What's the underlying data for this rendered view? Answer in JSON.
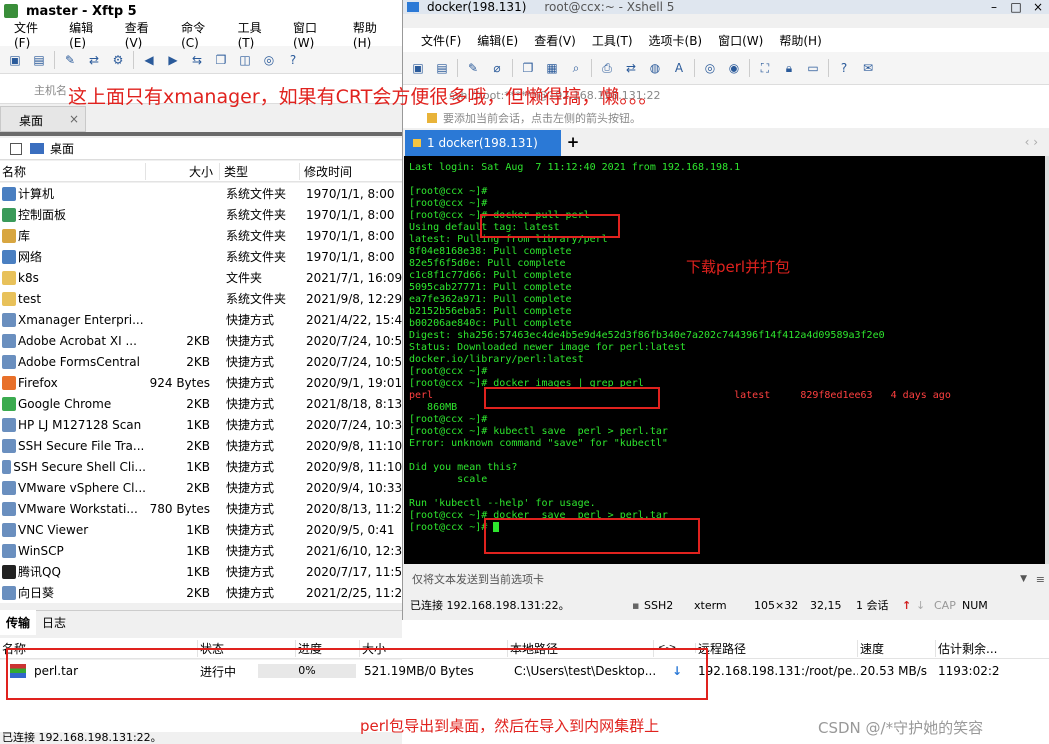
{
  "xftp": {
    "title": "master  - Xftp 5",
    "menu": [
      "文件(F)",
      "编辑(E)",
      "查看(V)",
      "命令(C)",
      "工具(T)",
      "窗口(W)",
      "帮助(H)"
    ],
    "address_placeholder": "主机名",
    "tab": "桌面",
    "path": "桌面",
    "columns": [
      "名称",
      "大小",
      "类型",
      "修改时间"
    ],
    "files": [
      {
        "name": "计算机",
        "size": "",
        "type": "系统文件夹",
        "date": "1970/1/1, 8:00",
        "icon": "computer-icon"
      },
      {
        "name": "控制面板",
        "size": "",
        "type": "系统文件夹",
        "date": "1970/1/1, 8:00",
        "icon": "control-panel-icon"
      },
      {
        "name": "库",
        "size": "",
        "type": "系统文件夹",
        "date": "1970/1/1, 8:00",
        "icon": "library-icon"
      },
      {
        "name": "网络",
        "size": "",
        "type": "系统文件夹",
        "date": "1970/1/1, 8:00",
        "icon": "network-icon"
      },
      {
        "name": "k8s",
        "size": "",
        "type": "文件夹",
        "date": "2021/7/1, 16:09",
        "icon": "folder-icon"
      },
      {
        "name": "test",
        "size": "",
        "type": "系统文件夹",
        "date": "2021/9/8, 12:29",
        "icon": "folder-icon"
      },
      {
        "name": "Xmanager Enterpri...",
        "size": "",
        "type": "快捷方式",
        "date": "2021/4/22, 15:46",
        "icon": "shortcut-icon"
      },
      {
        "name": "Adobe Acrobat XI ...",
        "size": "2KB",
        "type": "快捷方式",
        "date": "2020/7/24, 10:57",
        "icon": "shortcut-icon"
      },
      {
        "name": "Adobe FormsCentral",
        "size": "2KB",
        "type": "快捷方式",
        "date": "2020/7/24, 10:57",
        "icon": "shortcut-icon"
      },
      {
        "name": "Firefox",
        "size": "924 Bytes",
        "type": "快捷方式",
        "date": "2020/9/1, 19:01",
        "icon": "firefox-icon"
      },
      {
        "name": "Google Chrome",
        "size": "2KB",
        "type": "快捷方式",
        "date": "2021/8/18, 8:13",
        "icon": "chrome-icon"
      },
      {
        "name": "HP LJ M127128 Scan",
        "size": "1KB",
        "type": "快捷方式",
        "date": "2020/7/24, 10:36",
        "icon": "shortcut-icon"
      },
      {
        "name": "SSH Secure File Tra...",
        "size": "2KB",
        "type": "快捷方式",
        "date": "2020/9/8, 11:10",
        "icon": "shortcut-icon"
      },
      {
        "name": "SSH Secure Shell Cli...",
        "size": "1KB",
        "type": "快捷方式",
        "date": "2020/9/8, 11:10",
        "icon": "shortcut-icon"
      },
      {
        "name": "VMware vSphere Cl...",
        "size": "2KB",
        "type": "快捷方式",
        "date": "2020/9/4, 10:33",
        "icon": "shortcut-icon"
      },
      {
        "name": "VMware Workstati...",
        "size": "780 Bytes",
        "type": "快捷方式",
        "date": "2020/8/13, 11:25",
        "icon": "shortcut-icon"
      },
      {
        "name": "VNC Viewer",
        "size": "1KB",
        "type": "快捷方式",
        "date": "2020/9/5, 0:41",
        "icon": "shortcut-icon"
      },
      {
        "name": "WinSCP",
        "size": "1KB",
        "type": "快捷方式",
        "date": "2021/6/10, 12:36",
        "icon": "shortcut-icon"
      },
      {
        "name": "腾讯QQ",
        "size": "1KB",
        "type": "快捷方式",
        "date": "2020/7/17, 11:50",
        "icon": "qq-icon"
      },
      {
        "name": "向日葵",
        "size": "2KB",
        "type": "快捷方式",
        "date": "2021/2/25, 11:27",
        "icon": "shortcut-icon"
      }
    ],
    "bottom_tabs": [
      "传输",
      "日志"
    ],
    "transfer_columns": [
      "名称",
      "状态",
      "进度",
      "大小",
      "本地路径",
      "<->",
      "远程路径",
      "速度",
      "估计剩余..."
    ],
    "transfer": {
      "name": "perl.tar",
      "status": "进行中",
      "progress_text": "0%",
      "progress": 0,
      "size": "521.19MB/0 Bytes",
      "local": "C:\\Users\\test\\Desktop...",
      "remote": "192.168.198.131:/root/pe...",
      "speed": "20.53 MB/s",
      "eta": "1193:02:2"
    },
    "status": "已连接 192.168.198.131:22。"
  },
  "xshell": {
    "title": "docker(198.131)",
    "title_suffix": "root@ccx:~ - Xshell 5",
    "menu": [
      "文件(F)",
      "编辑(E)",
      "查看(V)",
      "工具(T)",
      "选项卡(B)",
      "窗口(W)",
      "帮助(H)"
    ],
    "address": "ssh://root:******@192.168.198.131:22",
    "hint": "要添加当前会话，点击左侧的箭头按钮。",
    "tab": "1 docker(198.131)",
    "terminal_lines": [
      "Last login: Sat Aug  7 11:12:40 2021 from 192.168.198.1",
      "",
      "[root@ccx ~]#",
      "[root@ccx ~]#",
      "[root@ccx ~]# docker pull perl",
      "Using default tag: latest",
      "latest: Pulling from library/perl",
      "8f04e8168e38: Pull complete",
      "82e5f6f5d0e: Pull complete",
      "c1c8f1c77d66: Pull complete",
      "5095cab27771: Pull complete",
      "ea7fe362a971: Pull complete",
      "b2152b56eba5: Pull complete",
      "b00206ae840c: Pull complete",
      "Digest: sha256:57463ec4de4b5e9d4e52d3f86fb340e7a202c744396f14f412a4d09589a3f2e0",
      "Status: Downloaded newer image for perl:latest",
      "docker.io/library/perl:latest",
      "[root@ccx ~]#",
      "[root@ccx ~]# docker images | grep perl",
      "perl                                                  latest     829f8ed1ee63   4 days ago",
      "   860MB",
      "[root@ccx ~]#",
      "[root@ccx ~]# kubectl save  perl > perl.tar",
      "Error: unknown command \"save\" for \"kubectl\"",
      "",
      "Did you mean this?",
      "        scale",
      "",
      "Run 'kubectl --help' for usage.",
      "[root@ccx ~]# docker  save  perl > perl.tar",
      "[root@ccx ~]# "
    ],
    "send_hint": "仅将文本发送到当前选项卡",
    "status": {
      "connected": "已连接 192.168.198.131:22。",
      "protocol": "SSH2",
      "term": "xterm",
      "size": "105×32",
      "pos": "32,15",
      "sessions": "1 会话",
      "cap": "CAP",
      "num": "NUM"
    }
  },
  "annotations": {
    "top": "这上面只有xmanager，如果有CRT会方便很多哦，但懒得搞，懒。。。",
    "right": "下载perl并打包",
    "bottom": "perl包导出到桌面，然后在导入到内网集群上",
    "watermark": "CSDN @/*守护她的笑容"
  },
  "colors": {
    "annotation": "#e0221e",
    "terminal_bg": "#000000",
    "terminal_fg": "#2ee62e",
    "tab_active": "#2b79d6"
  }
}
